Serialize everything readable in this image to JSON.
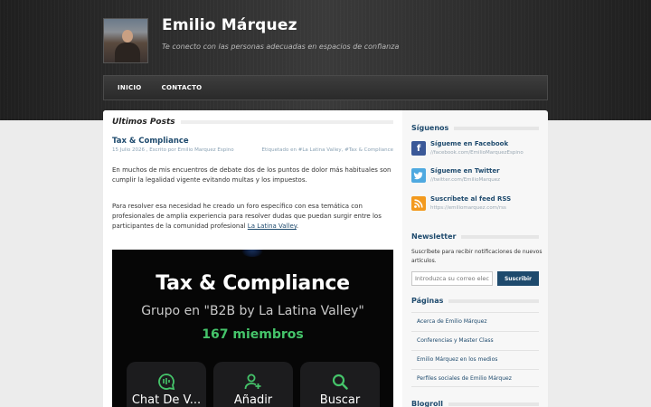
{
  "header": {
    "title": "Emilio Márquez",
    "tagline": "Te conecto con las personas adecuadas en espacios de confianza"
  },
  "nav": {
    "items": [
      "INICIO",
      "CONTACTO"
    ]
  },
  "main": {
    "section_title": "Ultimos Posts",
    "post": {
      "title": "Tax & Compliance",
      "meta_left": "15 Julio 2026 , Escrito por Emilio Marquez Espino",
      "meta_right": "Etiquetado en #La Latina Valley, #Tax & Compliance",
      "paragraph1": "En muchos de mis encuentros de debate dos de los puntos de dolor más habituales son cumplir la legalidad vigente evitando multas y los impuestos.",
      "paragraph2_text": "Para resolver esa necesidad he creado un foro específico con esa temática con profesionales de amplia experiencia para resolver dudas que puedan surgir entre los participantes de la comunidad profesional ",
      "paragraph2_link": "La Latina Valley",
      "paragraph2_end": ".",
      "image": {
        "title": "Tax & Compliance",
        "subtitle": "Grupo en \"B2B by La Latina Valley\"",
        "members": "167 miembros",
        "buttons": [
          {
            "label": "Chat De V...",
            "icon": "chat-icon"
          },
          {
            "label": "Añadir",
            "icon": "add-user-icon"
          },
          {
            "label": "Buscar",
            "icon": "search-icon"
          }
        ],
        "accent": "#45c46a"
      }
    }
  },
  "sidebar": {
    "follow": {
      "heading": "Síguenos",
      "items": [
        {
          "title": "Sígueme en Facebook",
          "url": "//facebook.com/EmilioMarquezEspino",
          "icon": "facebook-icon",
          "color": "#3b5998"
        },
        {
          "title": "Sígueme en Twitter",
          "url": "//twitter.com/EmilioMarquez",
          "icon": "twitter-icon",
          "color": "#4fa9e0"
        },
        {
          "title": "Suscríbete al feed RSS",
          "url": "https://emiliomarquez.com/rss",
          "icon": "rss-icon",
          "color": "#f39a1e"
        }
      ]
    },
    "newsletter": {
      "heading": "Newsletter",
      "text": "Suscríbete para recibir notificaciones de nuevos artículos.",
      "placeholder": "Introduzca su correo elec",
      "button": "Suscribir"
    },
    "pages": {
      "heading": "Páginas",
      "items": [
        "Acerca de Emilio Márquez",
        "Conferencias y Master Class",
        "Emilio Márquez en los medios",
        "Perfiles sociales de Emilio Márquez"
      ]
    },
    "blogroll": {
      "heading": "Blogroll"
    }
  },
  "colors": {
    "brand": "#1e4a6d",
    "header_bg": "#2c2c2c"
  }
}
